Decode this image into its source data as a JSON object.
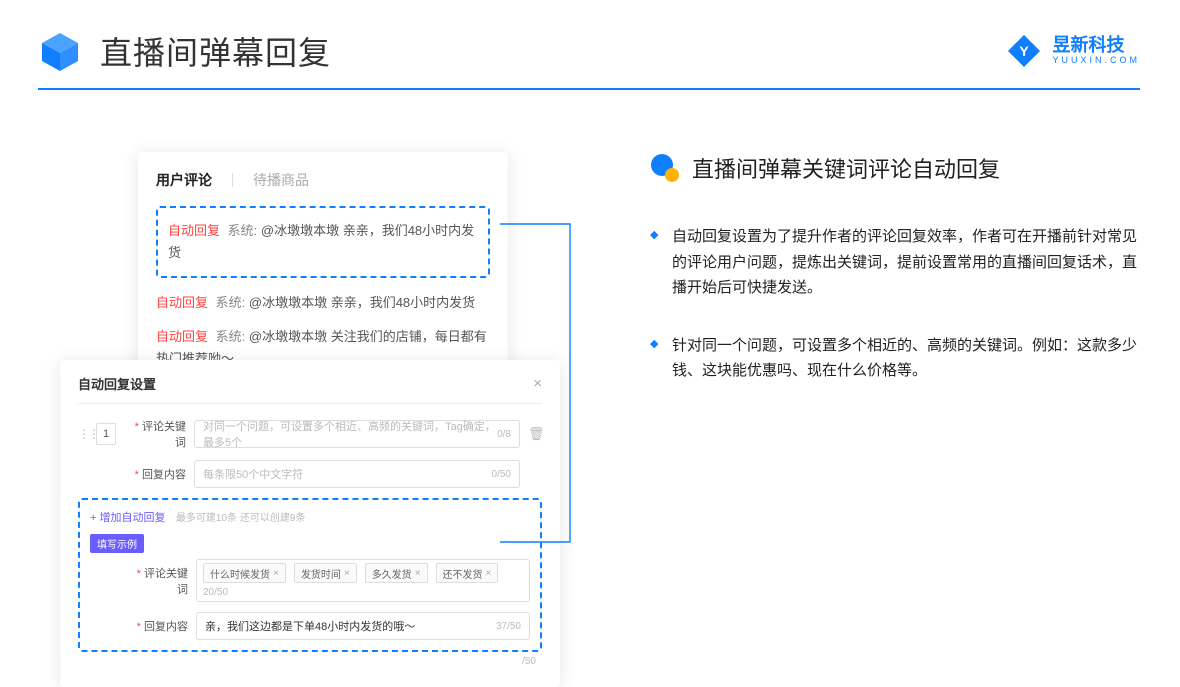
{
  "header": {
    "title": "直播间弹幕回复",
    "brand_name": "昱新科技",
    "brand_url": "YUUXIN.COM"
  },
  "comments_card": {
    "tab_active": "用户评论",
    "tab_other": "待播商品",
    "highlighted": {
      "tag": "自动回复",
      "system": "系统:",
      "text": "@冰墩墩本墩 亲亲，我们48小时内发货"
    },
    "msg2": {
      "tag": "自动回复",
      "system": "系统:",
      "text": "@冰墩墩本墩 亲亲，我们48小时内发货"
    },
    "msg3": {
      "tag": "自动回复",
      "system": "系统:",
      "text": "@冰墩墩本墩 关注我们的店铺，每日都有热门推荐呦～"
    }
  },
  "settings_card": {
    "title": "自动回复设置",
    "close": "×",
    "num": "1",
    "row1_label": "评论关键词",
    "row1_placeholder": "对同一个问题，可设置多个相近、高频的关键词，Tag确定，最多5个",
    "row1_count": "0/8",
    "row2_label": "回复内容",
    "row2_placeholder": "每条限50个中文字符",
    "row2_count": "0/50",
    "add_link": "+ 增加自动回复",
    "add_help": "最多可建10条 还可以创建9条",
    "sample_pill": "填写示例",
    "sample_row1_label": "评论关键词",
    "sample_tags": [
      "什么时候发货",
      "发货时间",
      "多久发货",
      "还不发货"
    ],
    "sample_row1_count": "20/50",
    "sample_row2_label": "回复内容",
    "sample_row2_value": "亲，我们这边都是下单48小时内发货的哦～",
    "sample_row2_count": "37/50",
    "outer_count": "/50"
  },
  "right": {
    "section_title": "直播间弹幕关键词评论自动回复",
    "bullet1": "自动回复设置为了提升作者的评论回复效率，作者可在开播前针对常见的评论用户问题，提炼出关键词，提前设置常用的直播间回复话术，直播开始后可快捷发送。",
    "bullet2": "针对同一个问题，可设置多个相近的、高频的关键词。例如：这款多少钱、这块能优惠吗、现在什么价格等。"
  }
}
